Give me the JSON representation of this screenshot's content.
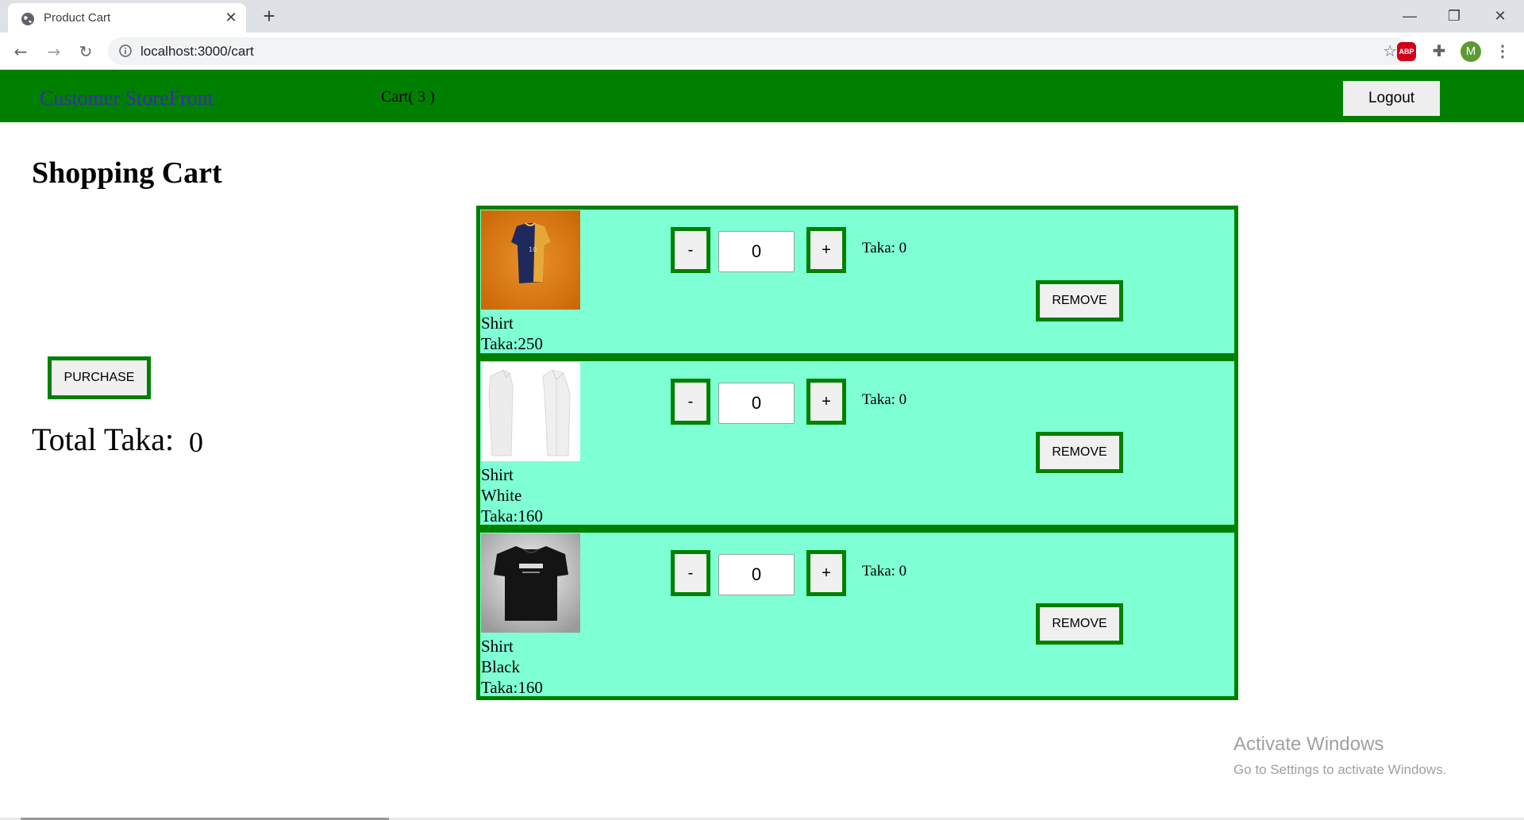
{
  "browser": {
    "tab_title": "Product Cart",
    "tab_close": "✕",
    "new_tab": "+",
    "url": "localhost:3000/cart",
    "window_controls": {
      "minimize": "—",
      "restore": "❐",
      "close": "✕"
    },
    "nav": {
      "back": "←",
      "forward": "→",
      "reload": "↻"
    },
    "star": "☆",
    "extensions": {
      "abp": "ABP",
      "puzzle": "✚",
      "avatar": "M",
      "menu": "⋮"
    }
  },
  "navbar": {
    "brand": "Customer StoreFront",
    "cart_label": "Cart(   3  )",
    "logout_label": "Logout",
    "colors": {
      "background": "#008000",
      "brand_text": "#3a2bb3"
    }
  },
  "page": {
    "title": "Shopping Cart",
    "purchase_label": "PURCHASE",
    "total_label": "Total Taka:",
    "total_value": "0"
  },
  "cart": {
    "items": [
      {
        "image_icon": "orange-navy-shirt-image",
        "name": "Shirt",
        "color": "",
        "price": "Taka:250",
        "qty": "0",
        "subtotal": "Taka: 0",
        "minus": "-",
        "plus": "+",
        "remove": "REMOVE"
      },
      {
        "image_icon": "white-shirt-image",
        "name": "Shirt",
        "color": "White",
        "price": "Taka:160",
        "qty": "0",
        "subtotal": "Taka: 0",
        "minus": "-",
        "plus": "+",
        "remove": "REMOVE"
      },
      {
        "image_icon": "black-tshirt-image",
        "name": "Shirt",
        "color": "Black",
        "price": "Taka:160",
        "qty": "0",
        "subtotal": "Taka: 0",
        "minus": "-",
        "plus": "+",
        "remove": "REMOVE"
      }
    ],
    "colors": {
      "item_background": "#7fffd4",
      "border": "#008000"
    }
  },
  "watermark": {
    "title": "Activate Windows",
    "subtitle": "Go to Settings to activate Windows."
  }
}
